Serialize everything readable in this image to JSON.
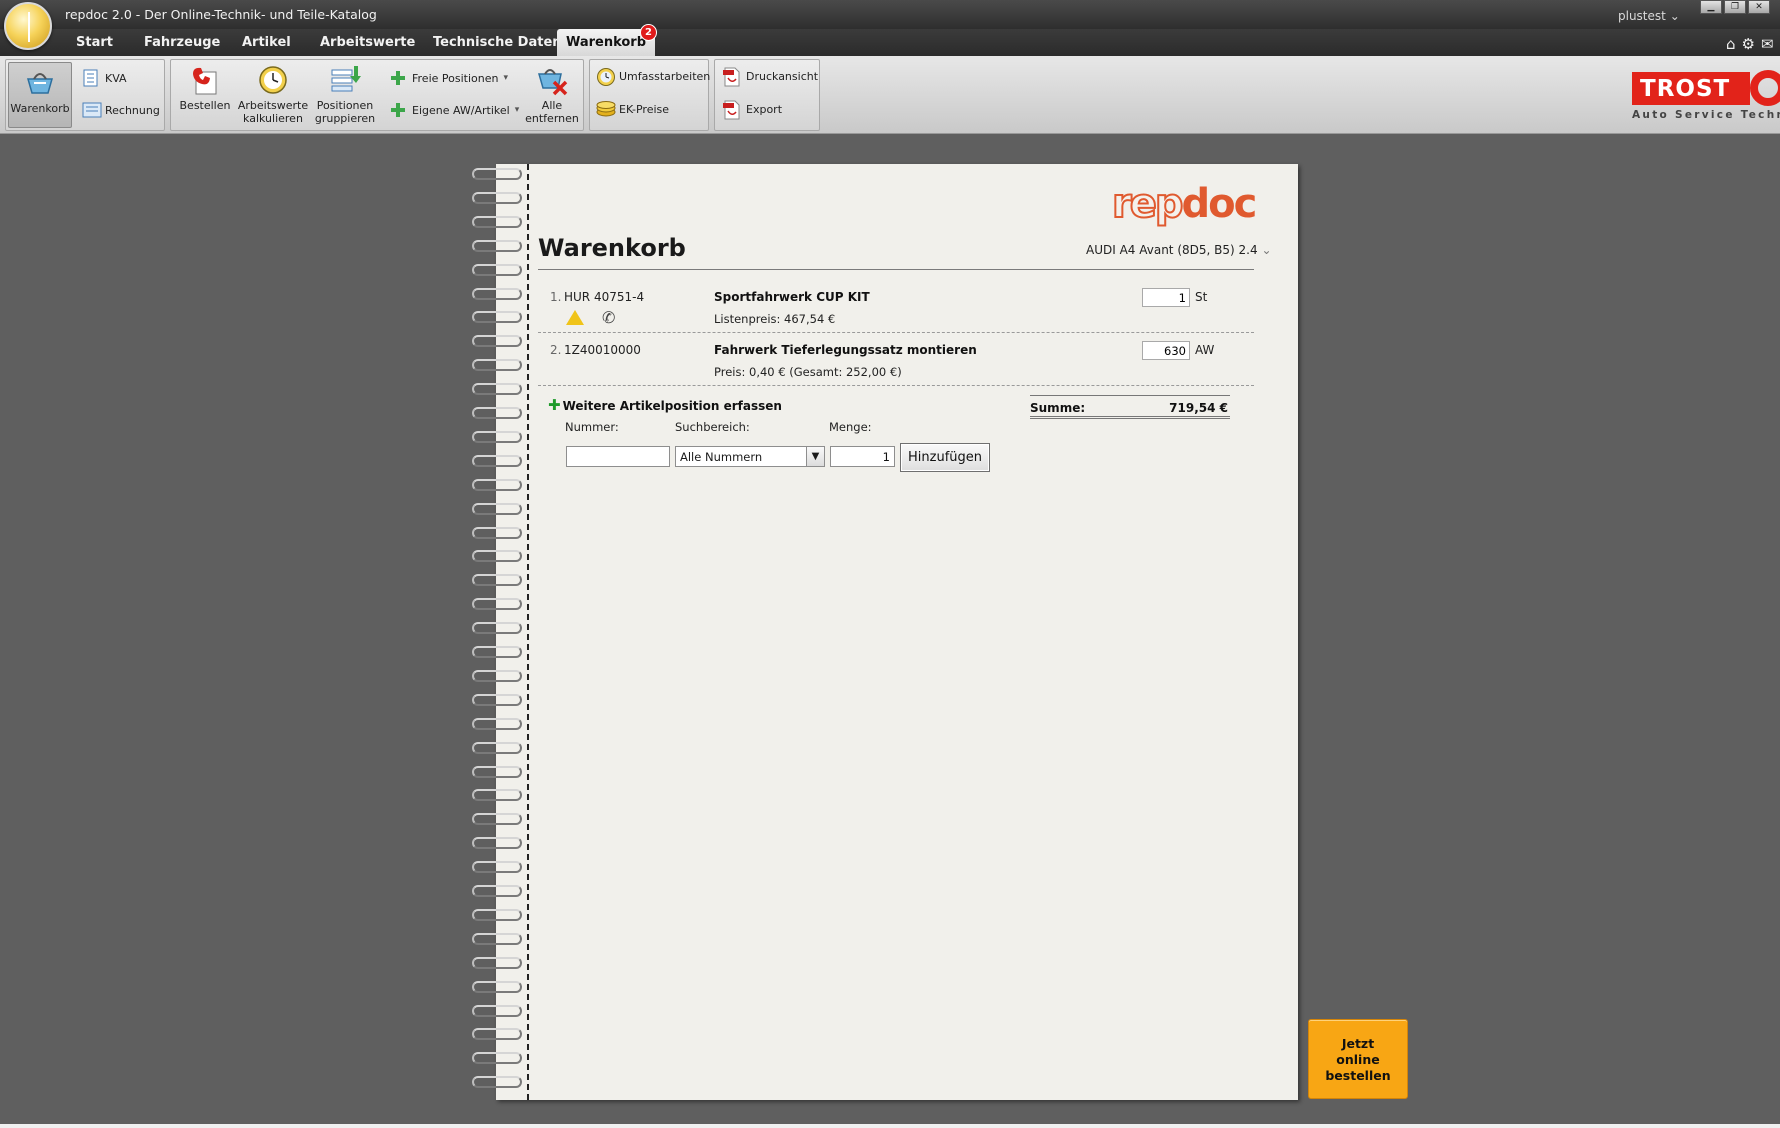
{
  "app": {
    "title": "repdoc 2.0 - Der Online-Technik- und Teile-Katalog",
    "user": "plustest",
    "win_buttons": [
      "▁",
      "❐",
      "✕"
    ]
  },
  "nav": {
    "tabs": [
      "Start",
      "Fahrzeuge",
      "Artikel",
      "Arbeitswerte",
      "Technische Daten"
    ],
    "active_tab": "Warenkorb",
    "cart_badge": "2"
  },
  "toolbar": {
    "warenkorb": "Warenkorb",
    "kva": "KVA",
    "rechnung": "Rechnung",
    "bestellen": "Bestellen",
    "arbeitswerte_line1": "Arbeitswerte",
    "arbeitswerte_line2": "kalkulieren",
    "positionen_line1": "Positionen",
    "positionen_line2": "gruppieren",
    "freie_positionen": "Freie Positionen",
    "eigene_aw": "Eigene AW/Artikel",
    "alle_line1": "Alle",
    "alle_line2": "entfernen",
    "umfassarbeiten": "Umfasstarbeiten",
    "ek_preise": "EK-Preise",
    "druckansicht": "Druckansicht",
    "export": "Export"
  },
  "brand": {
    "name": "TROST",
    "tagline": "Auto Service Techni",
    "repdoc_rep": "rep",
    "repdoc_doc": "doc"
  },
  "cart": {
    "title": "Warenkorb",
    "vehicle": "AUDI A4 Avant (8D5, B5) 2.4",
    "items": [
      {
        "num": "1.",
        "article": "HUR 40751-4",
        "name": "Sportfahrwerk CUP KIT",
        "price": "Listenpreis: 467,54 €",
        "qty": "1",
        "unit": "St"
      },
      {
        "num": "2.",
        "article": "1Z40010000",
        "name": "Fahrwerk Tieferlegungssatz montieren",
        "price": "Preis: 0,40 € (Gesamt: 252,00 €)",
        "qty": "630",
        "unit": "AW"
      }
    ],
    "add_heading": "Weitere Artikelposition erfassen",
    "sum_label": "Summe:",
    "sum_value": "719,54 €",
    "form": {
      "number_label": "Nummer:",
      "search_label": "Suchbereich:",
      "qty_label": "Menge:",
      "number_value": "",
      "search_value": "Alle Nummern",
      "qty_value": "1",
      "add_button": "Hinzufügen"
    }
  },
  "order_button": {
    "line1": "Jetzt",
    "line2": "online",
    "line3": "bestellen"
  },
  "icons": [
    "app-logo-icon",
    "home-icon",
    "gear-icon",
    "mail-icon",
    "basket-icon",
    "list-icon",
    "invoice-icon",
    "phone-order-icon",
    "clock-icon",
    "group-icon",
    "plus-icon",
    "remove-all-icon",
    "globe-clock-icon",
    "coins-icon",
    "pdf-icon",
    "warning-icon",
    "phone-icon"
  ]
}
